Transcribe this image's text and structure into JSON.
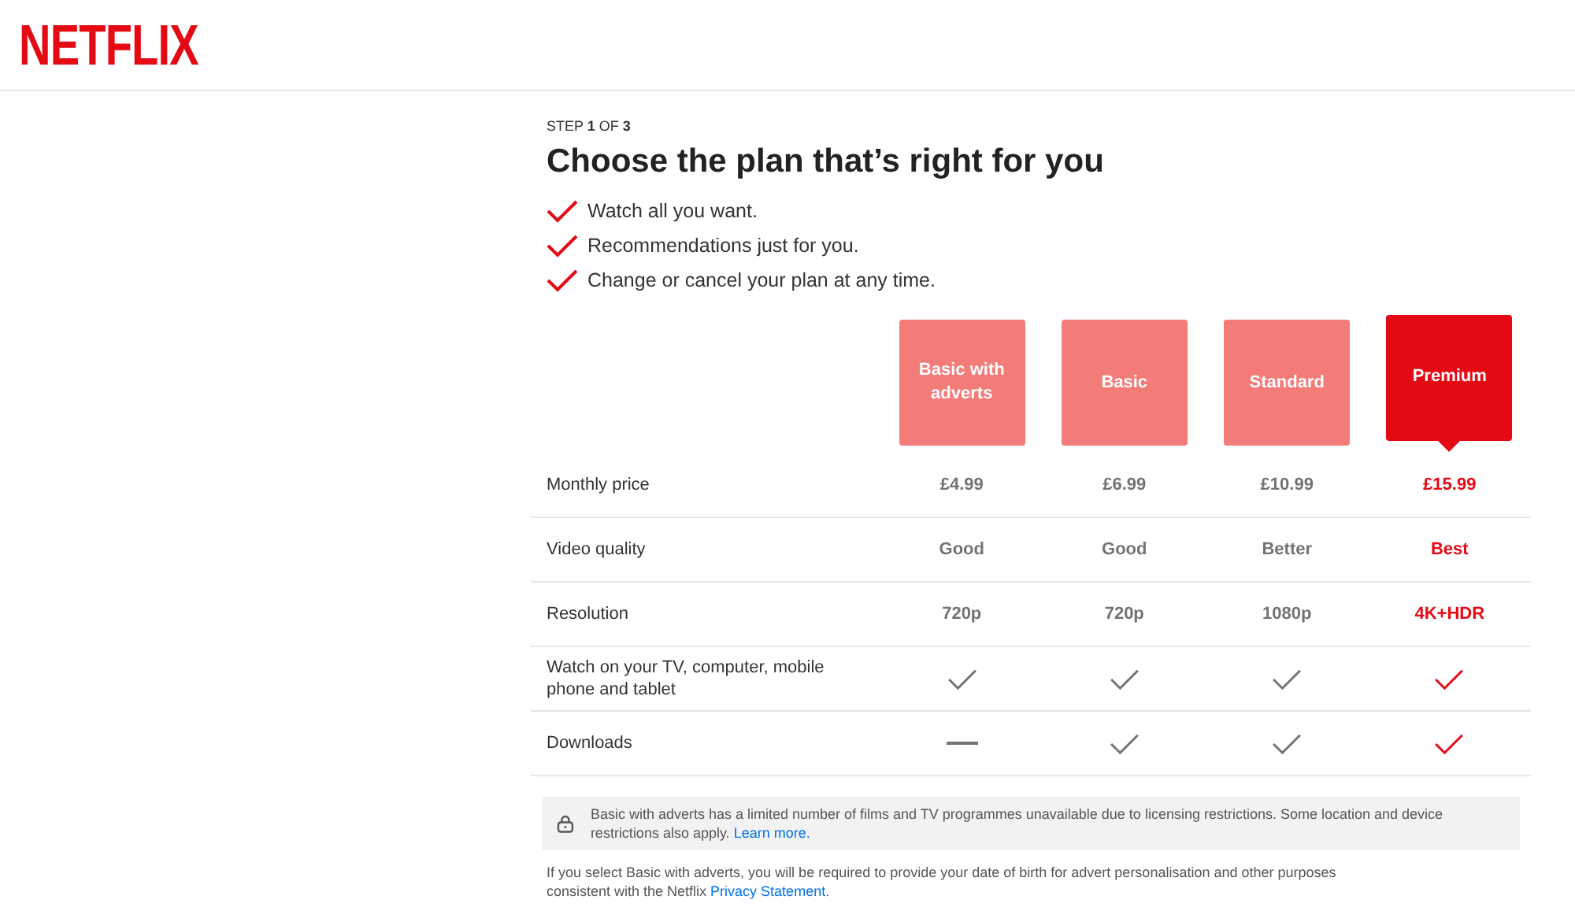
{
  "logo": "NETFLIX",
  "step": {
    "prefix": "STEP ",
    "current": "1",
    "middle": " OF ",
    "total": "3"
  },
  "title": "Choose the plan that’s right for you",
  "benefits": [
    "Watch all you want.",
    "Recommendations just for you.",
    "Change or cancel your plan at any time."
  ],
  "plans": [
    {
      "name": "Basic with adverts",
      "selected": false
    },
    {
      "name": "Basic",
      "selected": false
    },
    {
      "name": "Standard",
      "selected": false
    },
    {
      "name": "Premium",
      "selected": true
    }
  ],
  "rows": [
    {
      "label": "Monthly price",
      "cells": [
        {
          "kind": "text",
          "text": "£4.99"
        },
        {
          "kind": "text",
          "text": "£6.99"
        },
        {
          "kind": "text",
          "text": "£10.99"
        },
        {
          "kind": "text",
          "text": "£15.99"
        }
      ]
    },
    {
      "label": "Video quality",
      "cells": [
        {
          "kind": "text",
          "text": "Good"
        },
        {
          "kind": "text",
          "text": "Good"
        },
        {
          "kind": "text",
          "text": "Better"
        },
        {
          "kind": "text",
          "text": "Best"
        }
      ]
    },
    {
      "label": "Resolution",
      "cells": [
        {
          "kind": "text",
          "text": "720p"
        },
        {
          "kind": "text",
          "text": "720p"
        },
        {
          "kind": "text",
          "text": "1080p"
        },
        {
          "kind": "text",
          "text": "4K+HDR"
        }
      ]
    },
    {
      "label": "Watch on your TV, computer, mobile phone and tablet",
      "cells": [
        {
          "kind": "check"
        },
        {
          "kind": "check"
        },
        {
          "kind": "check"
        },
        {
          "kind": "check"
        }
      ]
    },
    {
      "label": "Downloads",
      "cells": [
        {
          "kind": "dash"
        },
        {
          "kind": "check"
        },
        {
          "kind": "check"
        },
        {
          "kind": "check"
        }
      ]
    }
  ],
  "notice": {
    "text": "Basic with adverts has a limited number of films and TV programmes unavailable due to licensing restrictions. Some location and device restrictions also apply.",
    "link": "Learn more."
  },
  "footnote": {
    "text": "If you select Basic with adverts, you will be required to provide your date of birth for advert personalisation and other purposes consistent with the Netflix",
    "link": "Privacy Statement."
  }
}
